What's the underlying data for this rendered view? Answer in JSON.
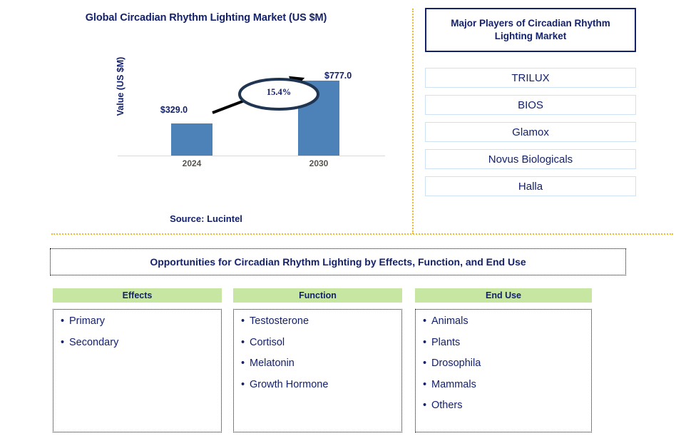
{
  "chart_panel": {
    "title": "Global Circadian Rhythm Lighting Market (US $M)",
    "y_axis_label": "Value (US $M)",
    "source": "Source: Lucintel"
  },
  "chart_data": {
    "type": "bar",
    "title": "Global Circadian Rhythm Lighting Market (US $M)",
    "xlabel": "",
    "ylabel": "Value (US $M)",
    "categories": [
      "2024",
      "2030"
    ],
    "values": [
      329.0,
      777.0
    ],
    "value_labels": [
      "$329.0",
      "$777.0"
    ],
    "ylim": [
      0,
      900
    ],
    "grid": false,
    "legend": "none",
    "bar_color": "#4d82b8",
    "annotations": [
      {
        "type": "cagr-callout",
        "label": "15.4%",
        "from": "2024",
        "to": "2030"
      }
    ]
  },
  "players": {
    "header": "Major Players of Circadian Rhythm Lighting Market",
    "items": [
      {
        "name": "TRILUX"
      },
      {
        "name": "BIOS"
      },
      {
        "name": "Glamox"
      },
      {
        "name": "Novus Biologicals"
      },
      {
        "name": "Halla"
      }
    ]
  },
  "opportunities": {
    "title": "Opportunities for Circadian Rhythm Lighting by Effects, Function, and End Use",
    "columns": [
      {
        "header": "Effects",
        "items": [
          "Primary",
          "Secondary"
        ]
      },
      {
        "header": "Function",
        "items": [
          "Testosterone",
          "Cortisol",
          "Melatonin",
          "Growth Hormone"
        ]
      },
      {
        "header": "End Use",
        "items": [
          "Animals",
          "Plants",
          "Drosophila",
          "Mammals",
          "Others"
        ]
      }
    ]
  },
  "theme": {
    "navy": "#14216b",
    "bar_blue": "#4d82b8",
    "divider_gold": "#f5bb1e",
    "header_green": "#c7e6a2",
    "player_border": "#cfe2f3"
  },
  "bullet_glyph": "•"
}
